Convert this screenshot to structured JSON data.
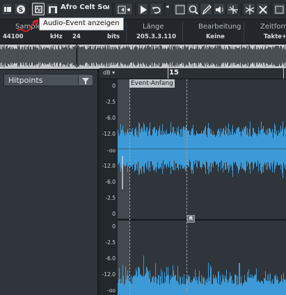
{
  "toolbar": {
    "clip_name": "Afro Celt Sour",
    "icons": [
      "info-icon",
      "solo-icon",
      "show-audio-event-icon",
      "snap-icon",
      "auto-scroll-icon",
      "play-icon",
      "loop-icon",
      "select-tool-icon",
      "zoom-tool-icon",
      "draw-tool-icon",
      "speaker-icon",
      "timewarp-icon",
      "hitpoint-tool-icon",
      "cut-icon"
    ]
  },
  "tooltip": {
    "text": "Audio-Event anzeigen"
  },
  "infoline": {
    "columns": [
      {
        "header": "Samplerate",
        "value": "44100"
      },
      {
        "header": "",
        "value": "kHz"
      },
      {
        "header": "",
        "value": "24"
      },
      {
        "header": "",
        "value": "bits"
      },
      {
        "header": "Länge",
        "value": "205.3.3.110"
      },
      {
        "header": "Bearbeitung",
        "value": "Keine"
      },
      {
        "header": "Zeitformat",
        "value": "Takte+Zä"
      }
    ]
  },
  "left_panel": {
    "section_label": "Hitpoints"
  },
  "editor": {
    "amplitude_unit": "dB",
    "ruler_label": "15",
    "event_start_label": "Event-Anfang",
    "marker_label": "R",
    "scale_ticks_top": [
      "0",
      "-2.5",
      "-6.0",
      "-12.0",
      "-oo",
      "-12.0",
      "-6.0",
      "-2.5",
      "0"
    ],
    "scale_ticks_bottom": [
      "0",
      "-2.5",
      "-6.0",
      "-12.0",
      "-oo"
    ]
  },
  "colors": {
    "waveform": "#3d9ad6",
    "lane_active": "#2f353b",
    "lane_dim": "#43494f",
    "overview_bg": "#c4c8cb",
    "annotation_red": "#d9262a"
  }
}
